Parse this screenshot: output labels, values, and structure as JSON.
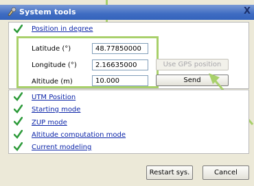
{
  "window": {
    "title": "System tools",
    "close_glyph": "X"
  },
  "position_section": {
    "header_label": "Position in degree",
    "latitude": {
      "label": "Latitude (°)",
      "value": "48.77850000"
    },
    "longitude": {
      "label": "Longitude (°)",
      "value": "2.16635000"
    },
    "altitude": {
      "label": "Altitude (m)",
      "value": "10.000"
    },
    "use_gps_label": "Use GPS position",
    "send_label": "Send"
  },
  "sections": [
    {
      "label": "UTM Position"
    },
    {
      "label": "Starting mode"
    },
    {
      "label": "ZUP mode"
    },
    {
      "label": "Altitude computation mode"
    },
    {
      "label": "Current modeling"
    }
  ],
  "footer": {
    "restart_label": "Restart sys.",
    "cancel_label": "Cancel"
  },
  "colors": {
    "highlight": "#a8d06a",
    "check": "#2e9b3b",
    "titlebar": "#3f6cc2",
    "link": "#0b24a8"
  },
  "icons": {
    "title": "tools-icon",
    "check": "checkmark-icon"
  }
}
